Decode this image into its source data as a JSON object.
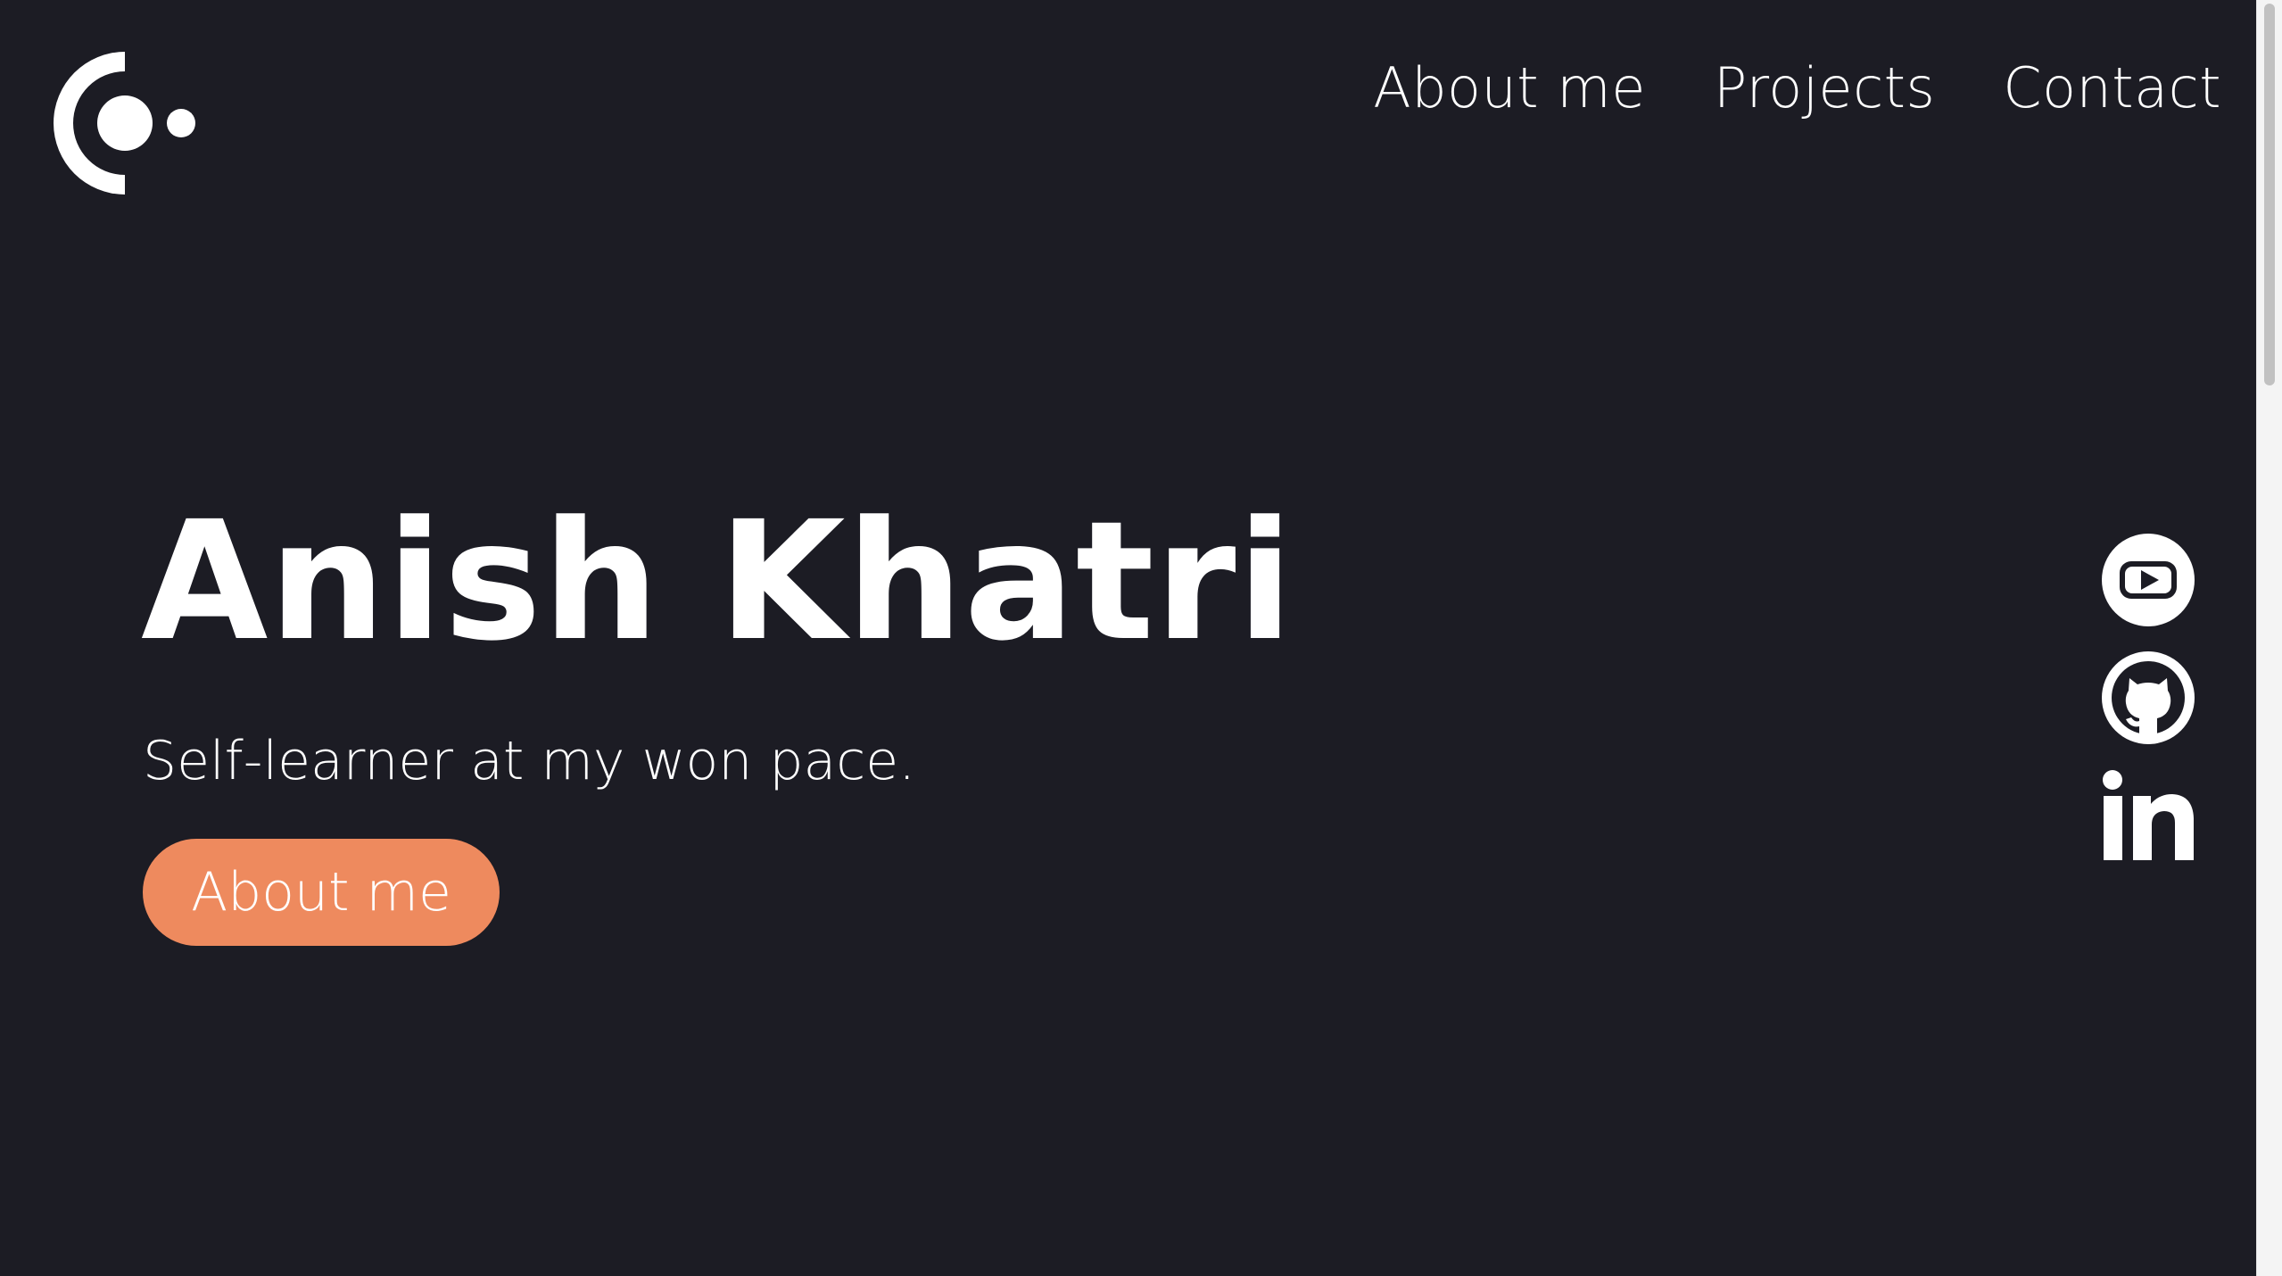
{
  "nav": {
    "items": [
      {
        "label": "About me"
      },
      {
        "label": "Projects"
      },
      {
        "label": "Contact"
      }
    ]
  },
  "hero": {
    "name": "Anish Khatri",
    "tagline": "Self-learner at my won pace.",
    "button_label": "About me"
  },
  "social": {
    "icons": [
      "youtube-icon",
      "github-icon",
      "linkedin-icon"
    ]
  },
  "colors": {
    "background": "#1c1c24",
    "accent": "#ee8a5e",
    "text": "#ffffff"
  }
}
